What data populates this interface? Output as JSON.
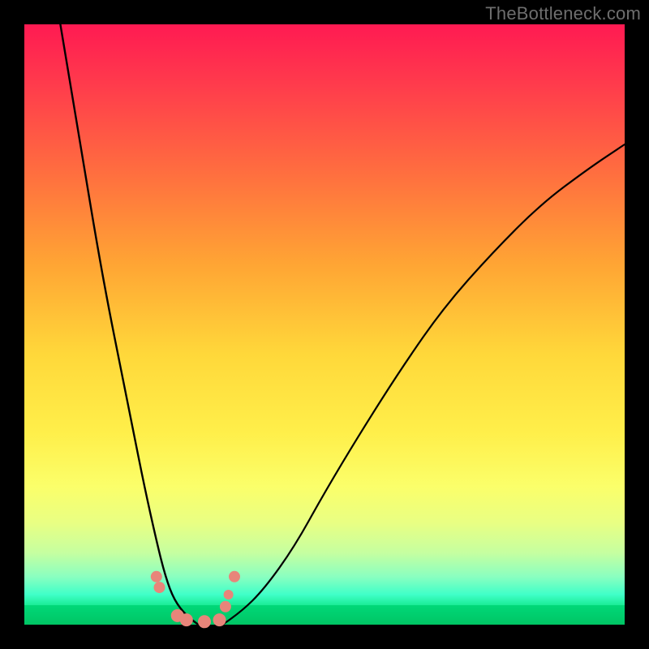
{
  "watermark": "TheBottleneck.com",
  "chart_data": {
    "type": "line",
    "title": "",
    "xlabel": "",
    "ylabel": "",
    "xlim": [
      0,
      100
    ],
    "ylim": [
      0,
      100
    ],
    "background_gradient": {
      "top": "#ff1a52",
      "mid": "#ffe74a",
      "bottom": "#00c564",
      "meaning": "red = high bottleneck, green = low bottleneck"
    },
    "series": [
      {
        "name": "left-curve",
        "x": [
          6,
          8,
          10,
          12,
          14,
          16,
          18,
          20,
          22,
          23.5,
          25,
          27,
          29
        ],
        "values": [
          100,
          88,
          76,
          64,
          53,
          43,
          33,
          23,
          14,
          8,
          4,
          1.5,
          0
        ]
      },
      {
        "name": "right-curve",
        "x": [
          33,
          36,
          40,
          45,
          50,
          56,
          63,
          70,
          78,
          86,
          94,
          100
        ],
        "values": [
          0,
          2,
          6,
          13,
          22,
          32,
          43,
          53,
          62,
          70,
          76,
          80
        ]
      }
    ],
    "points": {
      "name": "salmon-dots",
      "color": "#e8857a",
      "data": [
        {
          "x": 22.0,
          "y": 8.0,
          "r": 7
        },
        {
          "x": 22.5,
          "y": 6.2,
          "r": 7
        },
        {
          "x": 25.5,
          "y": 1.5,
          "r": 8
        },
        {
          "x": 27.0,
          "y": 0.8,
          "r": 8
        },
        {
          "x": 30.0,
          "y": 0.5,
          "r": 8
        },
        {
          "x": 32.5,
          "y": 0.8,
          "r": 8
        },
        {
          "x": 33.5,
          "y": 3.0,
          "r": 7
        },
        {
          "x": 34.0,
          "y": 5.0,
          "r": 6
        },
        {
          "x": 35.0,
          "y": 8.0,
          "r": 7
        }
      ]
    },
    "annotations": []
  }
}
